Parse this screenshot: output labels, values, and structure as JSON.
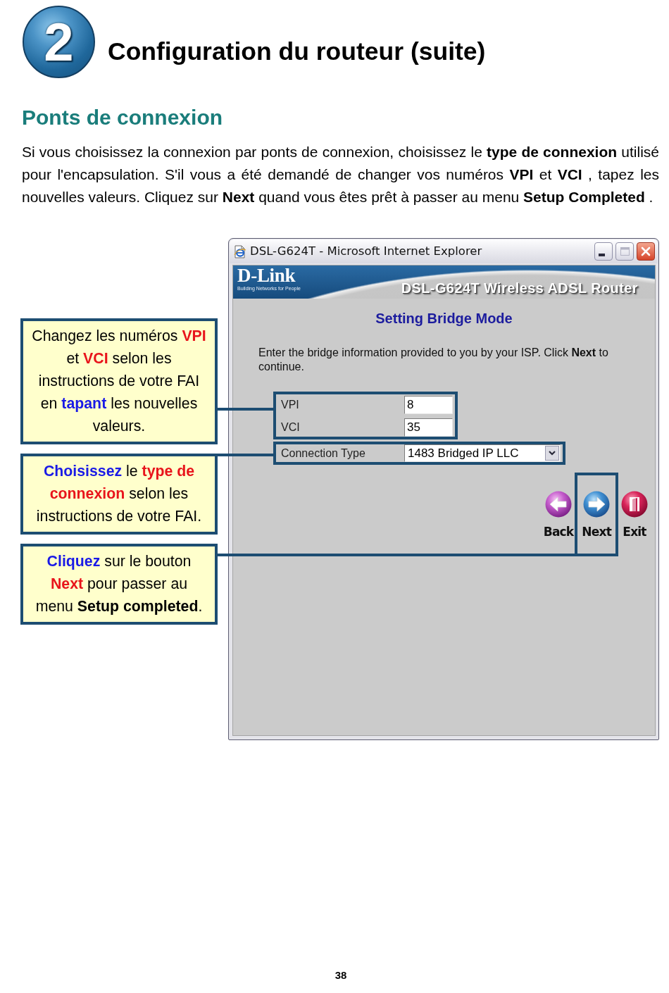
{
  "header": {
    "step_number": "2",
    "title": "Configuration du routeur (suite)"
  },
  "section": {
    "heading": "Ponts de connexion",
    "paragraph": "Si vous choisissez la connexion par ponts de connexion, choisissez le **type de connexion** utilisé pour l'encapsulation. S'il vous a été demandé de changer vos numéros **VPI** et **VCI** , tapez les nouvelles valeurs. Cliquez sur **Next** quand vous êtes prêt à passer au menu **Setup Completed** ."
  },
  "callouts": [
    {
      "segments": [
        {
          "kind": "plain",
          "text": "Changez les numéros "
        },
        {
          "kind": "term",
          "text": "VPI"
        },
        {
          "kind": "plain",
          "text": " et "
        },
        {
          "kind": "term",
          "text": "VCI"
        },
        {
          "kind": "plain",
          "text": " selon les instructions de votre FAI en "
        },
        {
          "kind": "action",
          "text": "tapant"
        },
        {
          "kind": "plain",
          "text": " les nouvelles valeurs."
        }
      ]
    },
    {
      "segments": [
        {
          "kind": "action",
          "text": "Choisissez"
        },
        {
          "kind": "plain",
          "text": " le "
        },
        {
          "kind": "term",
          "text": "type de connexion"
        },
        {
          "kind": "plain",
          "text": " selon les instructions de votre FAI."
        }
      ]
    },
    {
      "segments": [
        {
          "kind": "action",
          "text": "Cliquez"
        },
        {
          "kind": "plain",
          "text": " sur le bouton "
        },
        {
          "kind": "term",
          "text": "Next"
        },
        {
          "kind": "plain",
          "text": " pour passer au menu "
        },
        {
          "kind": "strong",
          "text": "Setup completed"
        },
        {
          "kind": "plain",
          "text": "."
        }
      ]
    }
  ],
  "window": {
    "title": "DSL-G624T - Microsoft Internet Explorer",
    "banner": {
      "logo": "D-Link",
      "tagline": "Building Networks for People",
      "product": "DSL-G624T Wireless ADSL Router"
    },
    "page_title": "Setting Bridge Mode",
    "instructions": "Enter the bridge information provided to you by your ISP. Click **Next** to continue.",
    "field_groups": [
      {
        "highlighted": true,
        "fields": [
          {
            "kind": "text",
            "label": "VPI",
            "value": "8"
          },
          {
            "kind": "text",
            "label": "VCI",
            "value": "35"
          }
        ]
      },
      {
        "highlighted": true,
        "fields": [
          {
            "kind": "select",
            "label": "Connection Type",
            "value": "1483 Bridged IP LLC"
          }
        ]
      }
    ],
    "nav_buttons": [
      {
        "kind": "back",
        "label": "Back",
        "highlighted": false
      },
      {
        "kind": "next",
        "label": "Next",
        "highlighted": true
      },
      {
        "kind": "exit",
        "label": "Exit",
        "highlighted": false
      }
    ]
  },
  "page_number": "38"
}
